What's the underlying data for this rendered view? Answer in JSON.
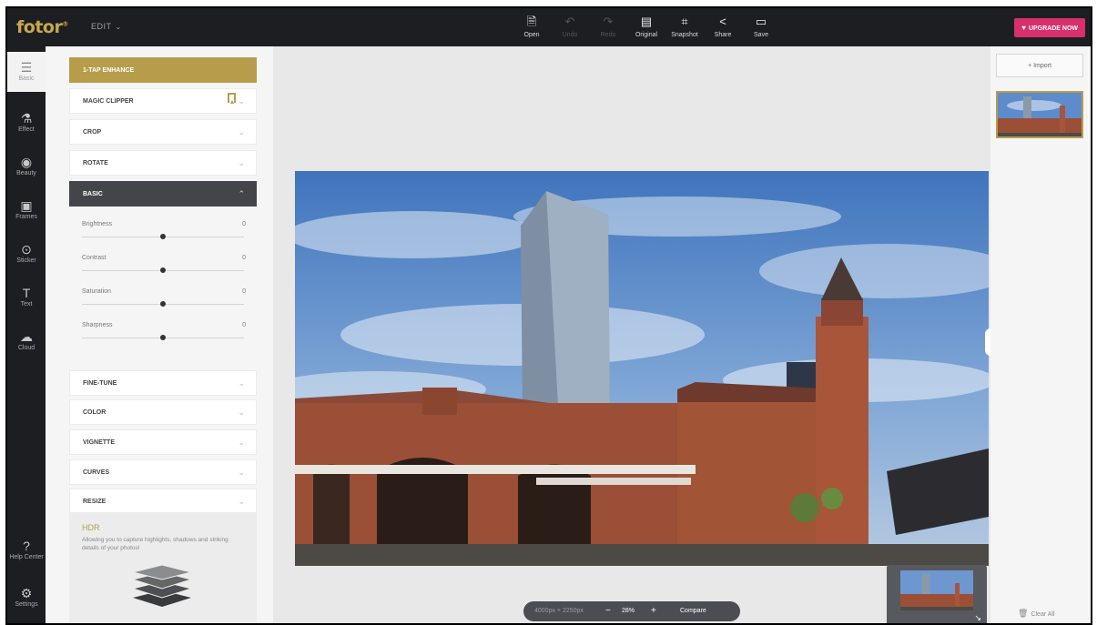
{
  "app": {
    "logo": "fotor",
    "logo_mark": "®",
    "menu_label": "EDIT",
    "upgrade_label": "UPGRADE NOW"
  },
  "toolbar": [
    {
      "label": "Open",
      "icon": "open-icon",
      "enabled": true
    },
    {
      "label": "Undo",
      "icon": "undo-icon",
      "enabled": false
    },
    {
      "label": "Redo",
      "icon": "redo-icon",
      "enabled": false
    },
    {
      "label": "Original",
      "icon": "original-icon",
      "enabled": true
    },
    {
      "label": "Snapshot",
      "icon": "snapshot-icon",
      "enabled": true
    },
    {
      "label": "Share",
      "icon": "share-icon",
      "enabled": true
    },
    {
      "label": "Save",
      "icon": "save-icon",
      "enabled": true
    }
  ],
  "rail": [
    {
      "label": "Basic",
      "icon": "sliders-icon",
      "active": true
    },
    {
      "label": "Effect",
      "icon": "flask-icon",
      "active": false
    },
    {
      "label": "Beauty",
      "icon": "eye-icon",
      "active": false
    },
    {
      "label": "Frames",
      "icon": "frame-icon",
      "active": false
    },
    {
      "label": "Sticker",
      "icon": "sticker-icon",
      "active": false
    },
    {
      "label": "Text",
      "icon": "text-icon",
      "active": false
    },
    {
      "label": "Cloud",
      "icon": "cloud-icon",
      "active": false
    },
    {
      "label": "Help Center",
      "icon": "help-icon",
      "active": false
    },
    {
      "label": "Settings",
      "icon": "settings-icon",
      "active": false
    }
  ],
  "panel": {
    "tap_enhance": "1-TAP ENHANCE",
    "magic_clipper": "MAGIC CLIPPER",
    "crop": "CROP",
    "rotate": "ROTATE",
    "basic": "BASIC",
    "sliders": [
      {
        "label": "Brightness",
        "value": "0",
        "position": 0.5
      },
      {
        "label": "Contrast",
        "value": "0",
        "position": 0.5
      },
      {
        "label": "Saturation",
        "value": "0",
        "position": 0.5
      },
      {
        "label": "Sharpness",
        "value": "0",
        "position": 0.5
      }
    ],
    "fine_tune": "FINE-TUNE",
    "color": "COLOR",
    "vignette": "VIGNETTE",
    "curves": "CURVES",
    "resize": "RESIZE",
    "hdr_title": "HDR",
    "hdr_desc": "Allowing you to capture highlights, shadows and striking details of your photos!"
  },
  "canvas": {
    "dimensions": "4000px × 2250px",
    "zoom_out": "−",
    "zoom": "28%",
    "zoom_in": "+",
    "compare": "Compare"
  },
  "right": {
    "import_label": "+ Import",
    "clear_all": "Clear All"
  },
  "colors": {
    "accent_gold": "#b79d4b",
    "upgrade_pink": "#d7306b",
    "topbar": "#1d1e22"
  }
}
